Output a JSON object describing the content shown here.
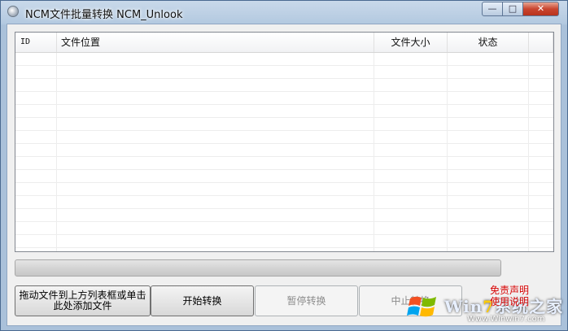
{
  "window": {
    "title": "NCM文件批量转换 NCM_Unlook",
    "min_glyph": "—",
    "max_glyph": "□",
    "close_glyph": "✕"
  },
  "file_list": {
    "columns": [
      "ID",
      "文件位置",
      "文件大小",
      "状态"
    ],
    "rows": []
  },
  "progress": {
    "value": 0
  },
  "buttons": {
    "add_files": "拖动文件到上方列表框或单击此处添加文件",
    "start": "开始转换",
    "pause": "暂停转换",
    "stop": "中止转换"
  },
  "watermark": {
    "disclaimer_line1": "免责声明",
    "disclaimer_line2": "使用说明",
    "brand_prefix": "Win",
    "brand_seven": "7",
    "brand_suffix": "系统之家",
    "brand_url": "Www.Winwin7.com"
  },
  "colors": {
    "progress_fill": "#3fb23f",
    "disclaimer": "#d40000",
    "close_button": "#c9452f"
  },
  "icons": {
    "app": "ncm-app-icon",
    "minimize": "minimize-icon",
    "maximize": "maximize-icon",
    "close": "close-icon",
    "windows_logo": "windows-logo-icon"
  }
}
